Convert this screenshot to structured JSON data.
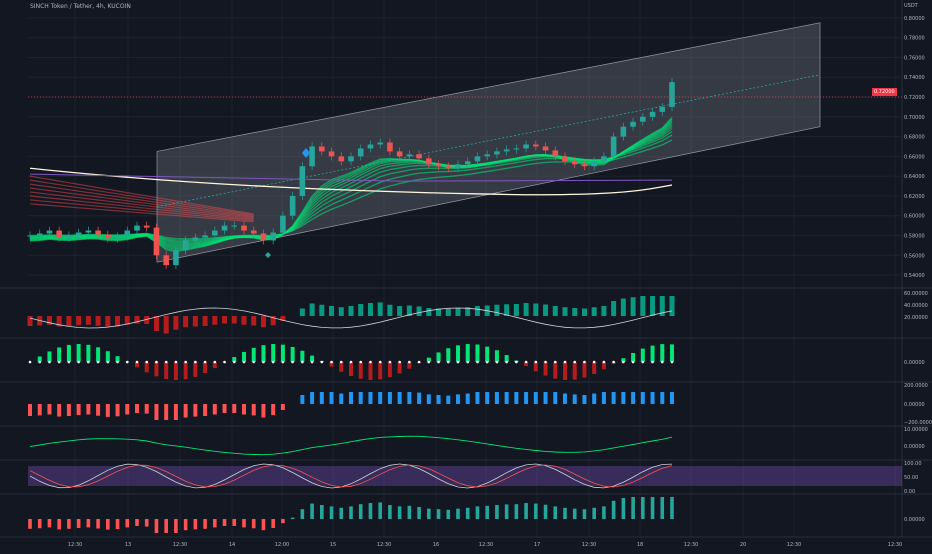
{
  "header": {
    "title": "SINCH Token / Tether, 4h, KUCOIN",
    "currency": "USDT"
  },
  "price_tag": {
    "label": "0.72000",
    "color": "#f23645"
  },
  "colors": {
    "background": "#131722",
    "grid": "#1e222d",
    "candle_up": "#26a69a",
    "candle_down": "#ef5350",
    "ribbon_green": "#00e676",
    "ribbon_red": "#ff5252",
    "channel_fill": "#787b86",
    "long_ma": "#fff8dc",
    "purple_ma": "#7e57c2",
    "osc_green": "#089981",
    "osc_red": "#b71c1c",
    "blue": "#2196f3",
    "pink": "#ff5252",
    "stoch_band": "#7e57c2"
  },
  "chart_data": {
    "type": "line",
    "title": "SINCH Token / Tether, 4h, KUCOIN",
    "x_tick_labels": [
      "12:30",
      "13",
      "12:30",
      "14",
      "12:00",
      "15",
      "12:30",
      "16",
      "12:30",
      "17",
      "12:30",
      "18",
      "12:30",
      "20",
      "12:30",
      "12:30"
    ],
    "main": {
      "y_ticks": [
        "0.80000",
        "0.78000",
        "0.76000",
        "0.74000",
        "0.72000",
        "0.70000",
        "0.68000",
        "0.66000",
        "0.64000",
        "0.62000",
        "0.60000",
        "0.58000",
        "0.56000",
        "0.54000"
      ],
      "ylim": [
        0.535,
        0.81
      ],
      "close_series_approx": [
        0.58,
        0.582,
        0.585,
        0.578,
        0.58,
        0.583,
        0.585,
        0.581,
        0.577,
        0.579,
        0.585,
        0.59,
        0.588,
        0.56,
        0.55,
        0.565,
        0.575,
        0.578,
        0.58,
        0.585,
        0.59,
        0.59,
        0.585,
        0.582,
        0.575,
        0.583,
        0.6,
        0.62,
        0.65,
        0.67,
        0.665,
        0.66,
        0.655,
        0.66,
        0.668,
        0.672,
        0.674,
        0.665,
        0.66,
        0.662,
        0.658,
        0.652,
        0.65,
        0.648,
        0.652,
        0.655,
        0.66,
        0.662,
        0.665,
        0.667,
        0.668,
        0.672,
        0.67,
        0.666,
        0.66,
        0.655,
        0.652,
        0.65,
        0.655,
        0.66,
        0.68,
        0.69,
        0.695,
        0.7,
        0.705,
        0.71,
        0.735
      ],
      "channel": {
        "upper": [
          0.665,
          0.795
        ],
        "lower": [
          0.553,
          0.69
        ]
      },
      "last_price": 0.72
    },
    "panes": [
      {
        "name": "osc1",
        "y_ticks": [
          "60.00000",
          "40.00000",
          "20.00000"
        ]
      },
      {
        "name": "osc2",
        "y_ticks": [
          "0.00000"
        ]
      },
      {
        "name": "osc3",
        "y_ticks": [
          "200.0000",
          "0.00000",
          "−200.0000"
        ]
      },
      {
        "name": "osc4",
        "y_ticks": [
          "10.00000",
          "0.00000"
        ]
      },
      {
        "name": "stoch",
        "y_ticks": [
          "100.00",
          "50.00",
          "0.00"
        ]
      },
      {
        "name": "osc6",
        "y_ticks": [
          "0.00000"
        ]
      }
    ]
  }
}
